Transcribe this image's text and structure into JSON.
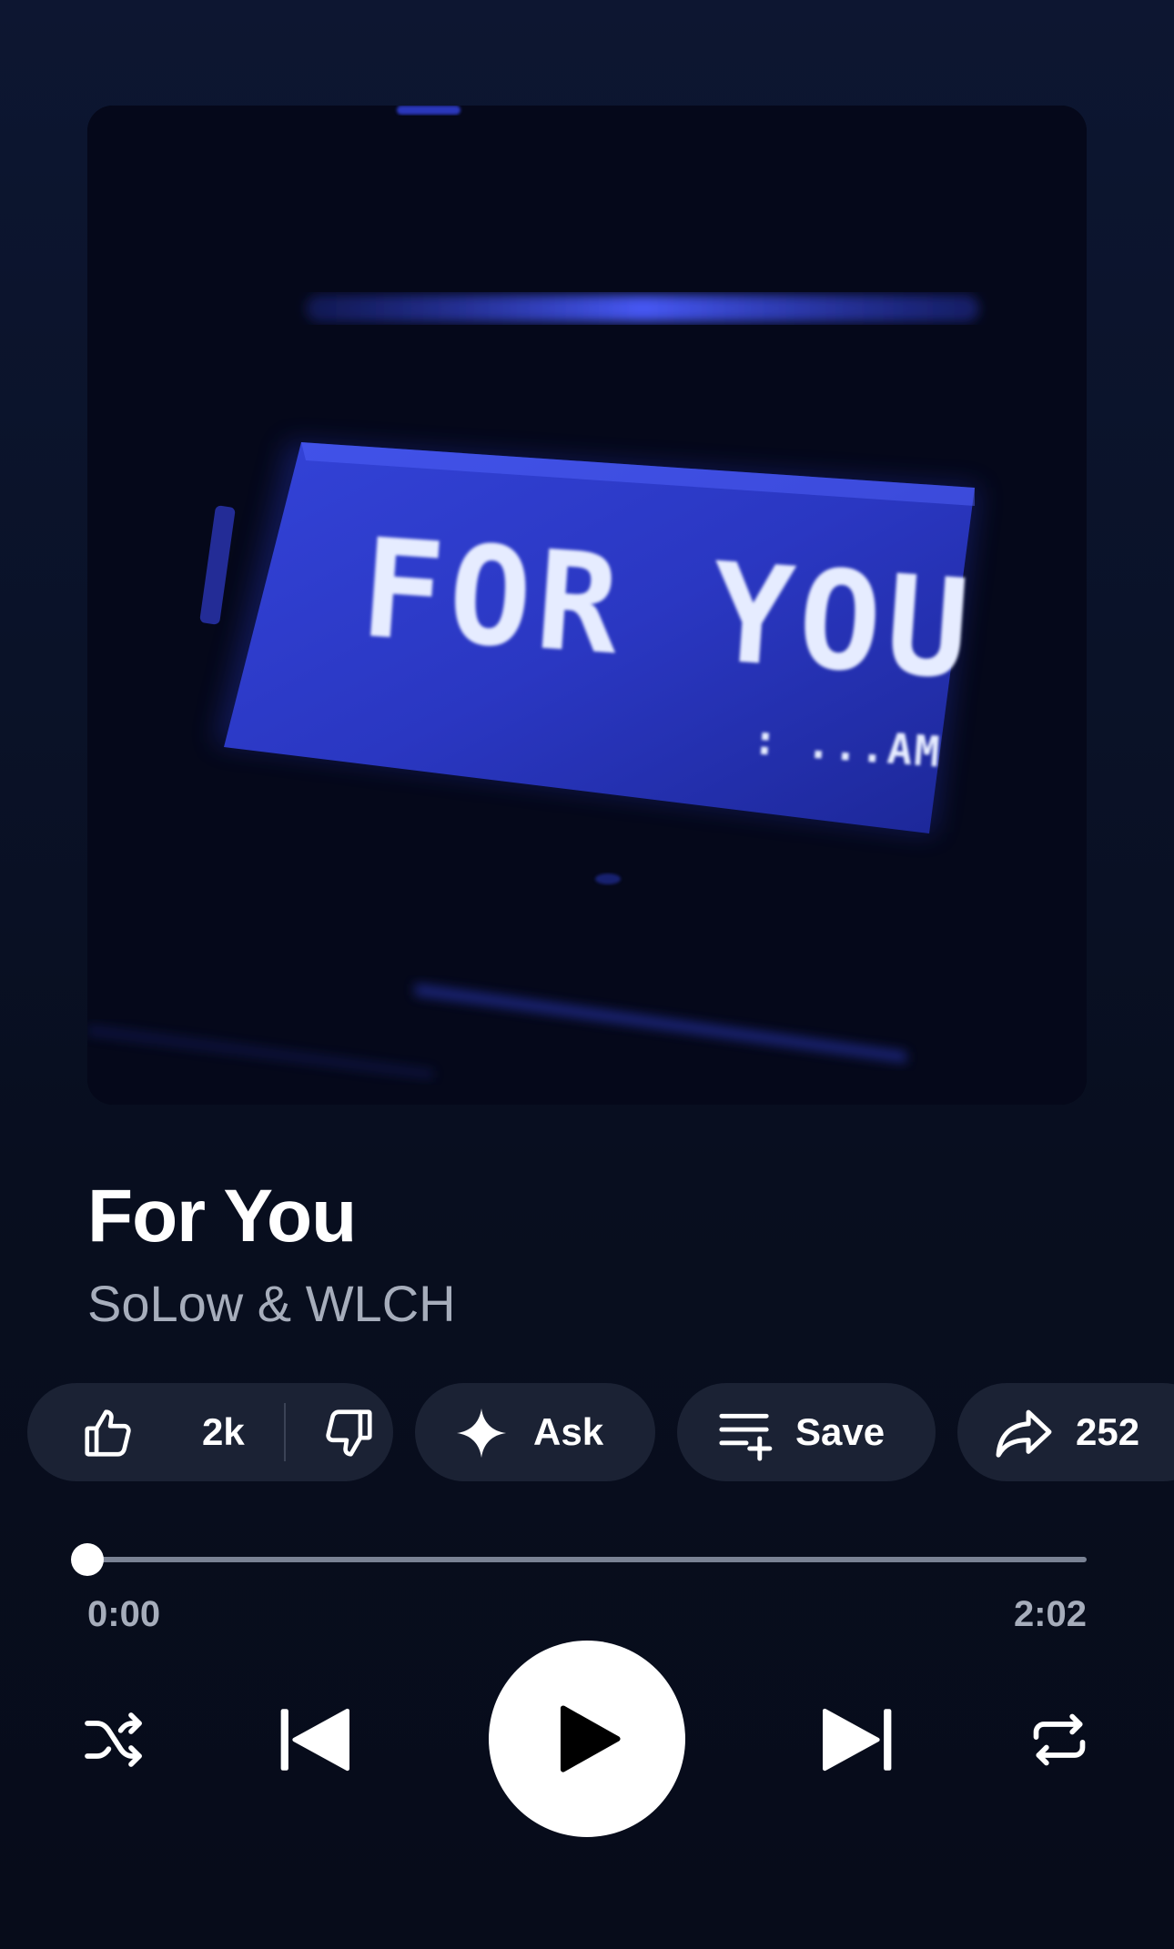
{
  "album_art": {
    "display_text": "FOR YOU",
    "display_subtext": ": ...AM"
  },
  "track": {
    "title": "For You",
    "artist": "SoLow & WLCH"
  },
  "actions": {
    "like_count": "2k",
    "ask_label": "Ask",
    "save_label": "Save",
    "share_count": "252"
  },
  "playback": {
    "current_time": "0:00",
    "total_time": "2:02",
    "progress_fraction": 0
  },
  "colors": {
    "background": "#0a1228",
    "chip_background": "#1b2234",
    "secondary_text": "#a6adbb",
    "display_blue": "#2c39c9"
  },
  "icons": {
    "like": "thumbs-up-icon",
    "dislike": "thumbs-down-icon",
    "ask": "sparkle-icon",
    "save": "playlist-add-icon",
    "share": "share-arrow-icon",
    "shuffle": "shuffle-icon",
    "previous": "skip-previous-icon",
    "play": "play-icon",
    "next": "skip-next-icon",
    "repeat": "repeat-icon"
  }
}
